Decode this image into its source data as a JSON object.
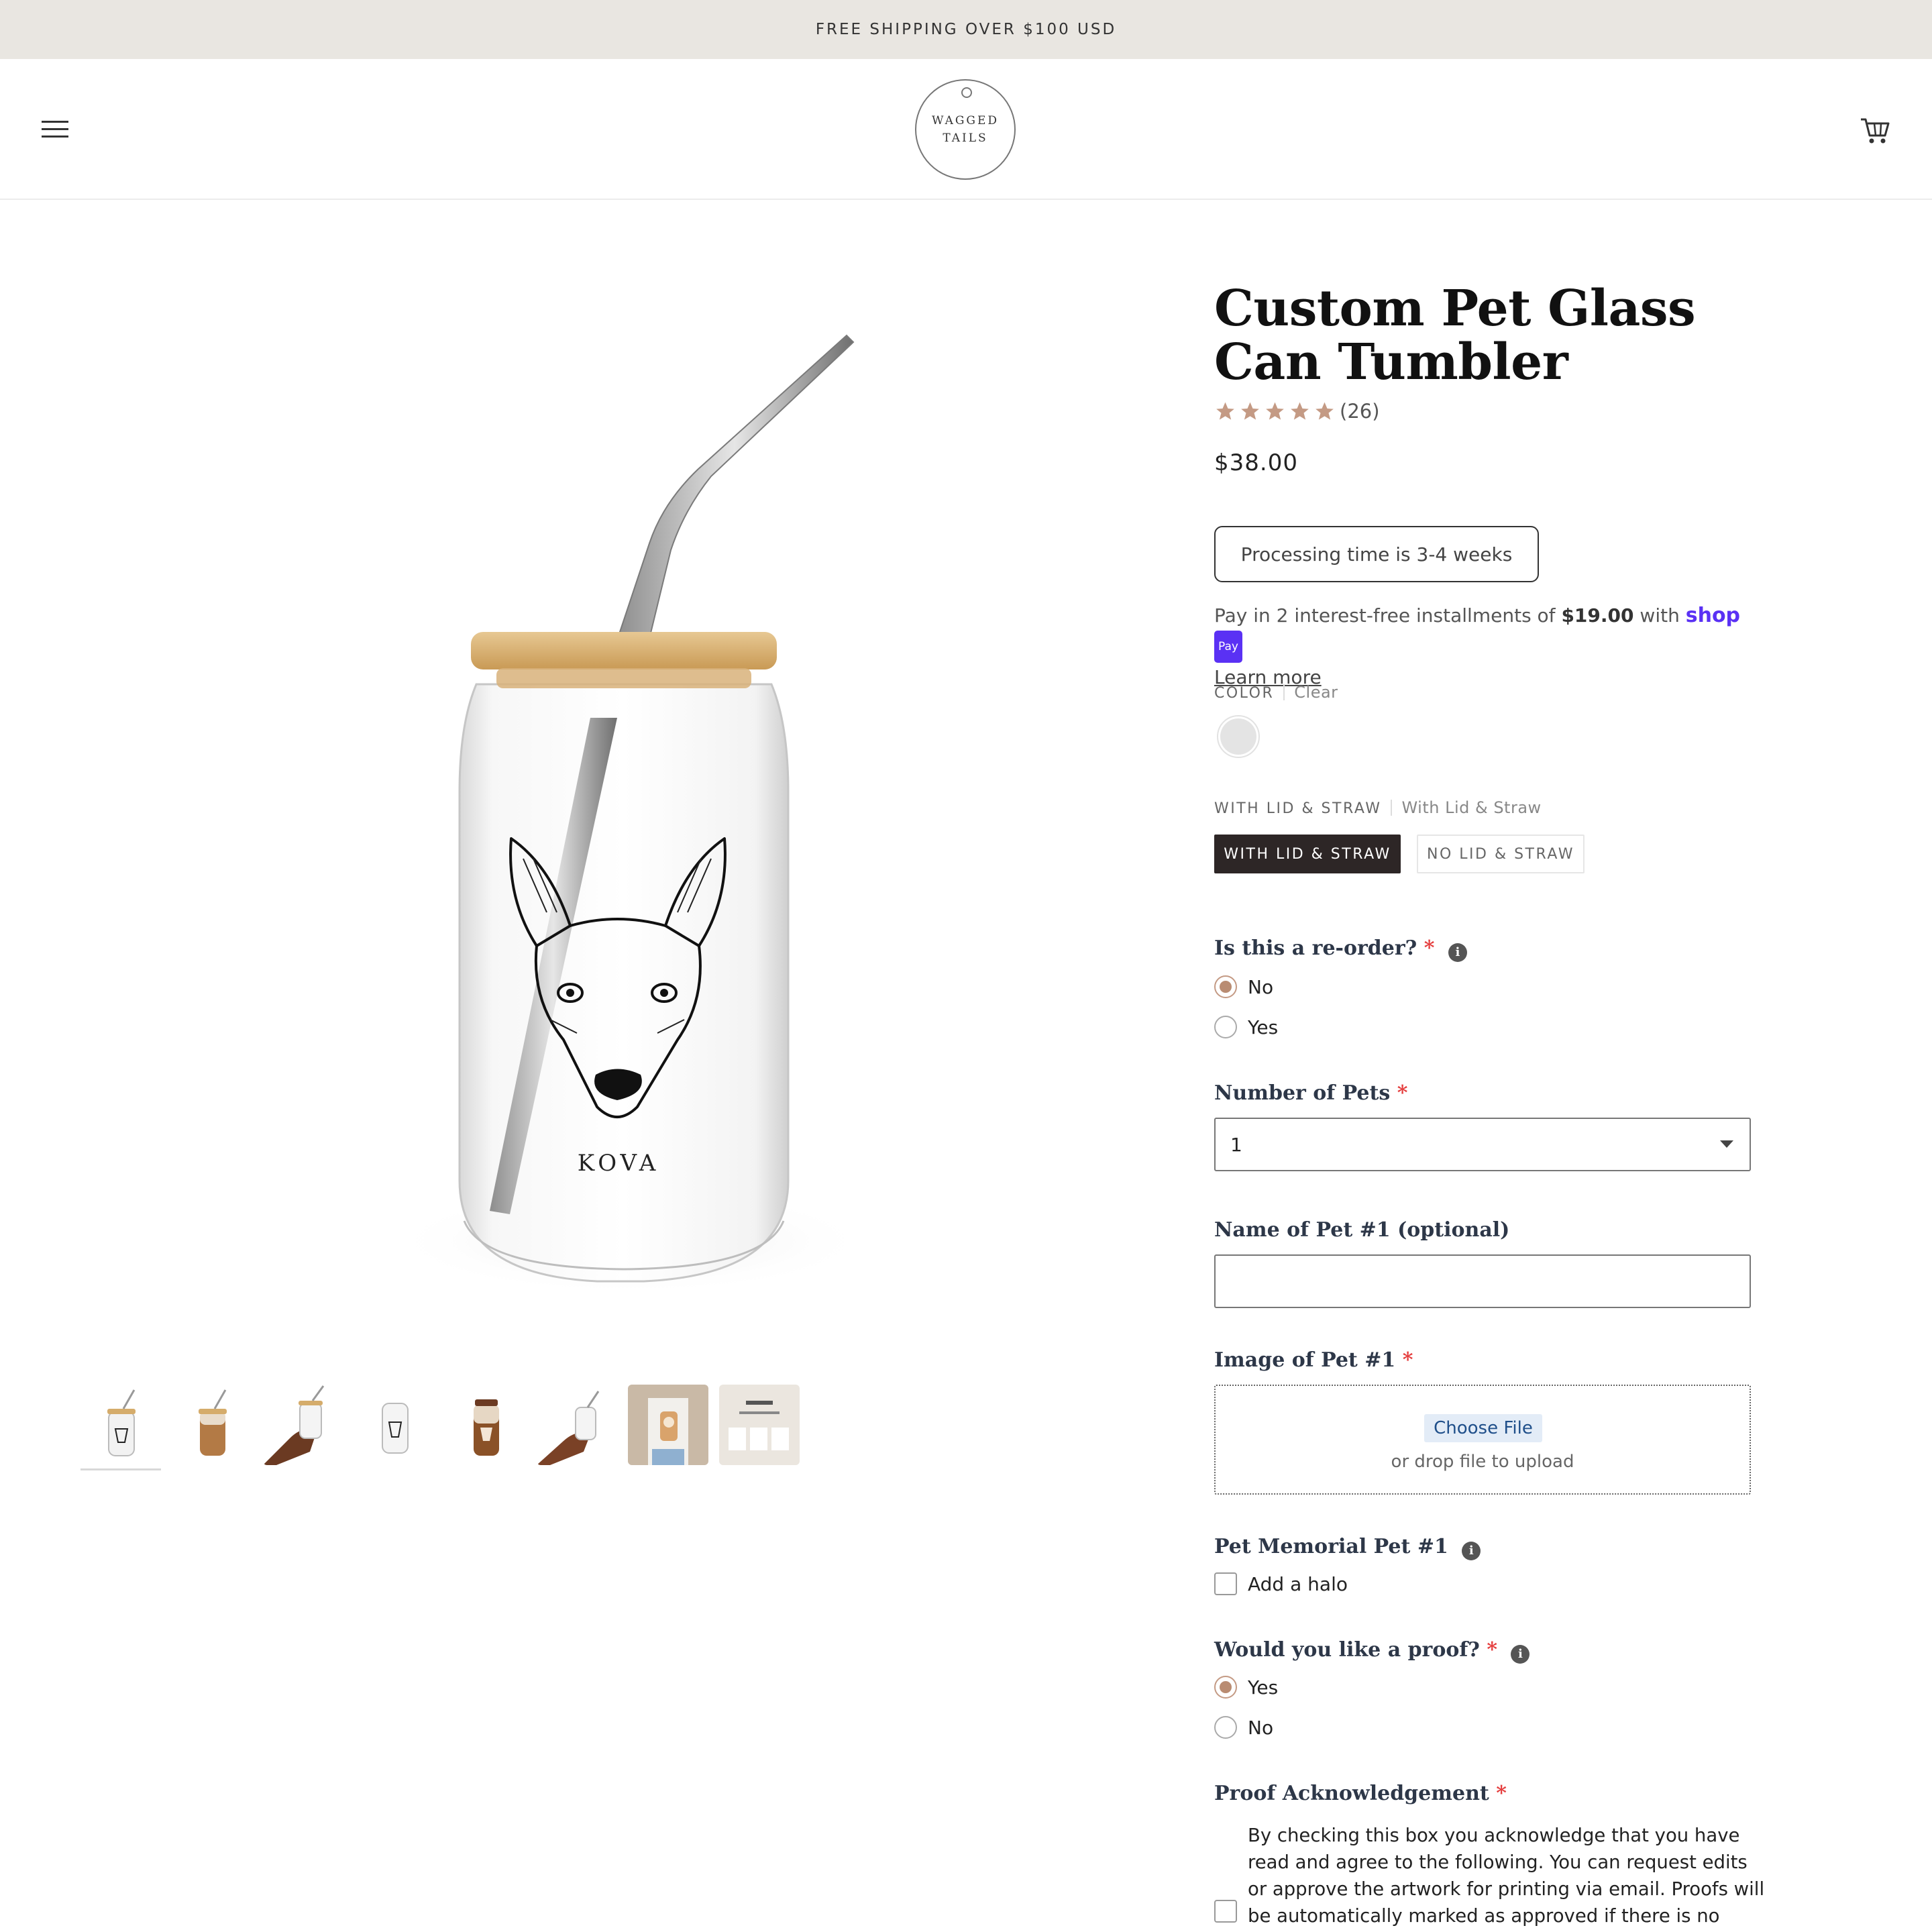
{
  "announcement": {
    "text": "FREE SHIPPING OVER $100 USD"
  },
  "header": {
    "logo_line1": "WAGGED",
    "logo_line2": "TAILS",
    "menu_icon": "hamburger-menu-icon",
    "cart_icon": "cart-icon"
  },
  "product": {
    "title": "Custom Pet Glass Can Tumbler",
    "rating": 5,
    "rating_max": 5,
    "review_count": "(26)",
    "price": "$38.00",
    "processing_note": "Processing time is 3-4 weeks",
    "image_label": "KOVA",
    "thumbnails": [
      {
        "name": "thumb-clear-glass"
      },
      {
        "name": "thumb-coffee-glass"
      },
      {
        "name": "thumb-hand-clear-glass"
      },
      {
        "name": "thumb-no-lid-glass"
      },
      {
        "name": "thumb-coffee-glass-2"
      },
      {
        "name": "thumb-hand-glass-2"
      },
      {
        "name": "thumb-lifestyle-photo"
      },
      {
        "name": "thumb-how-it-works"
      }
    ]
  },
  "shoppay": {
    "prefix": "Pay in 2 interest-free installments of ",
    "amount": "$19.00",
    "suffix": " with ",
    "brand": "shop",
    "badge": "Pay",
    "learn_more": "Learn more"
  },
  "options": {
    "color_label": "COLOR",
    "color_value": "Clear",
    "color_swatch": "#e4e4e4",
    "lid_label": "WITH LID & STRAW",
    "lid_value": "With Lid & Straw",
    "lid_choices": [
      "WITH LID & STRAW",
      "NO LID & STRAW"
    ]
  },
  "form": {
    "reorder_label": "Is this a re-order?",
    "reorder_options": [
      "No",
      "Yes"
    ],
    "reorder_selected": "No",
    "pets_label": "Number of Pets",
    "pets_value": "1",
    "name_label": "Name of Pet #1 (optional)",
    "name_value": "",
    "image_label": "Image of Pet #1",
    "choose_file": "Choose File",
    "drop_text": "or drop file to upload",
    "memorial_label": "Pet Memorial Pet #1",
    "halo_label": "Add a halo",
    "proof_label": "Would you like a proof?",
    "proof_options": [
      "Yes",
      "No"
    ],
    "proof_selected": "Yes",
    "ack_label": "Proof Acknowledgement",
    "ack_text": "By checking this box you acknowledge that you have read and agree to the following. You can request edits or approve the artwork for printing via email. Proofs will be automatically marked as approved if there is no response",
    "required_mark": "*",
    "info_mark": "i"
  },
  "colors": {
    "star": "#c49a84",
    "accent_radio": "#b98c72",
    "required": "#e53e3e",
    "shop_purple": "#5a31f4",
    "selected_variant_bg": "#2d2626"
  }
}
